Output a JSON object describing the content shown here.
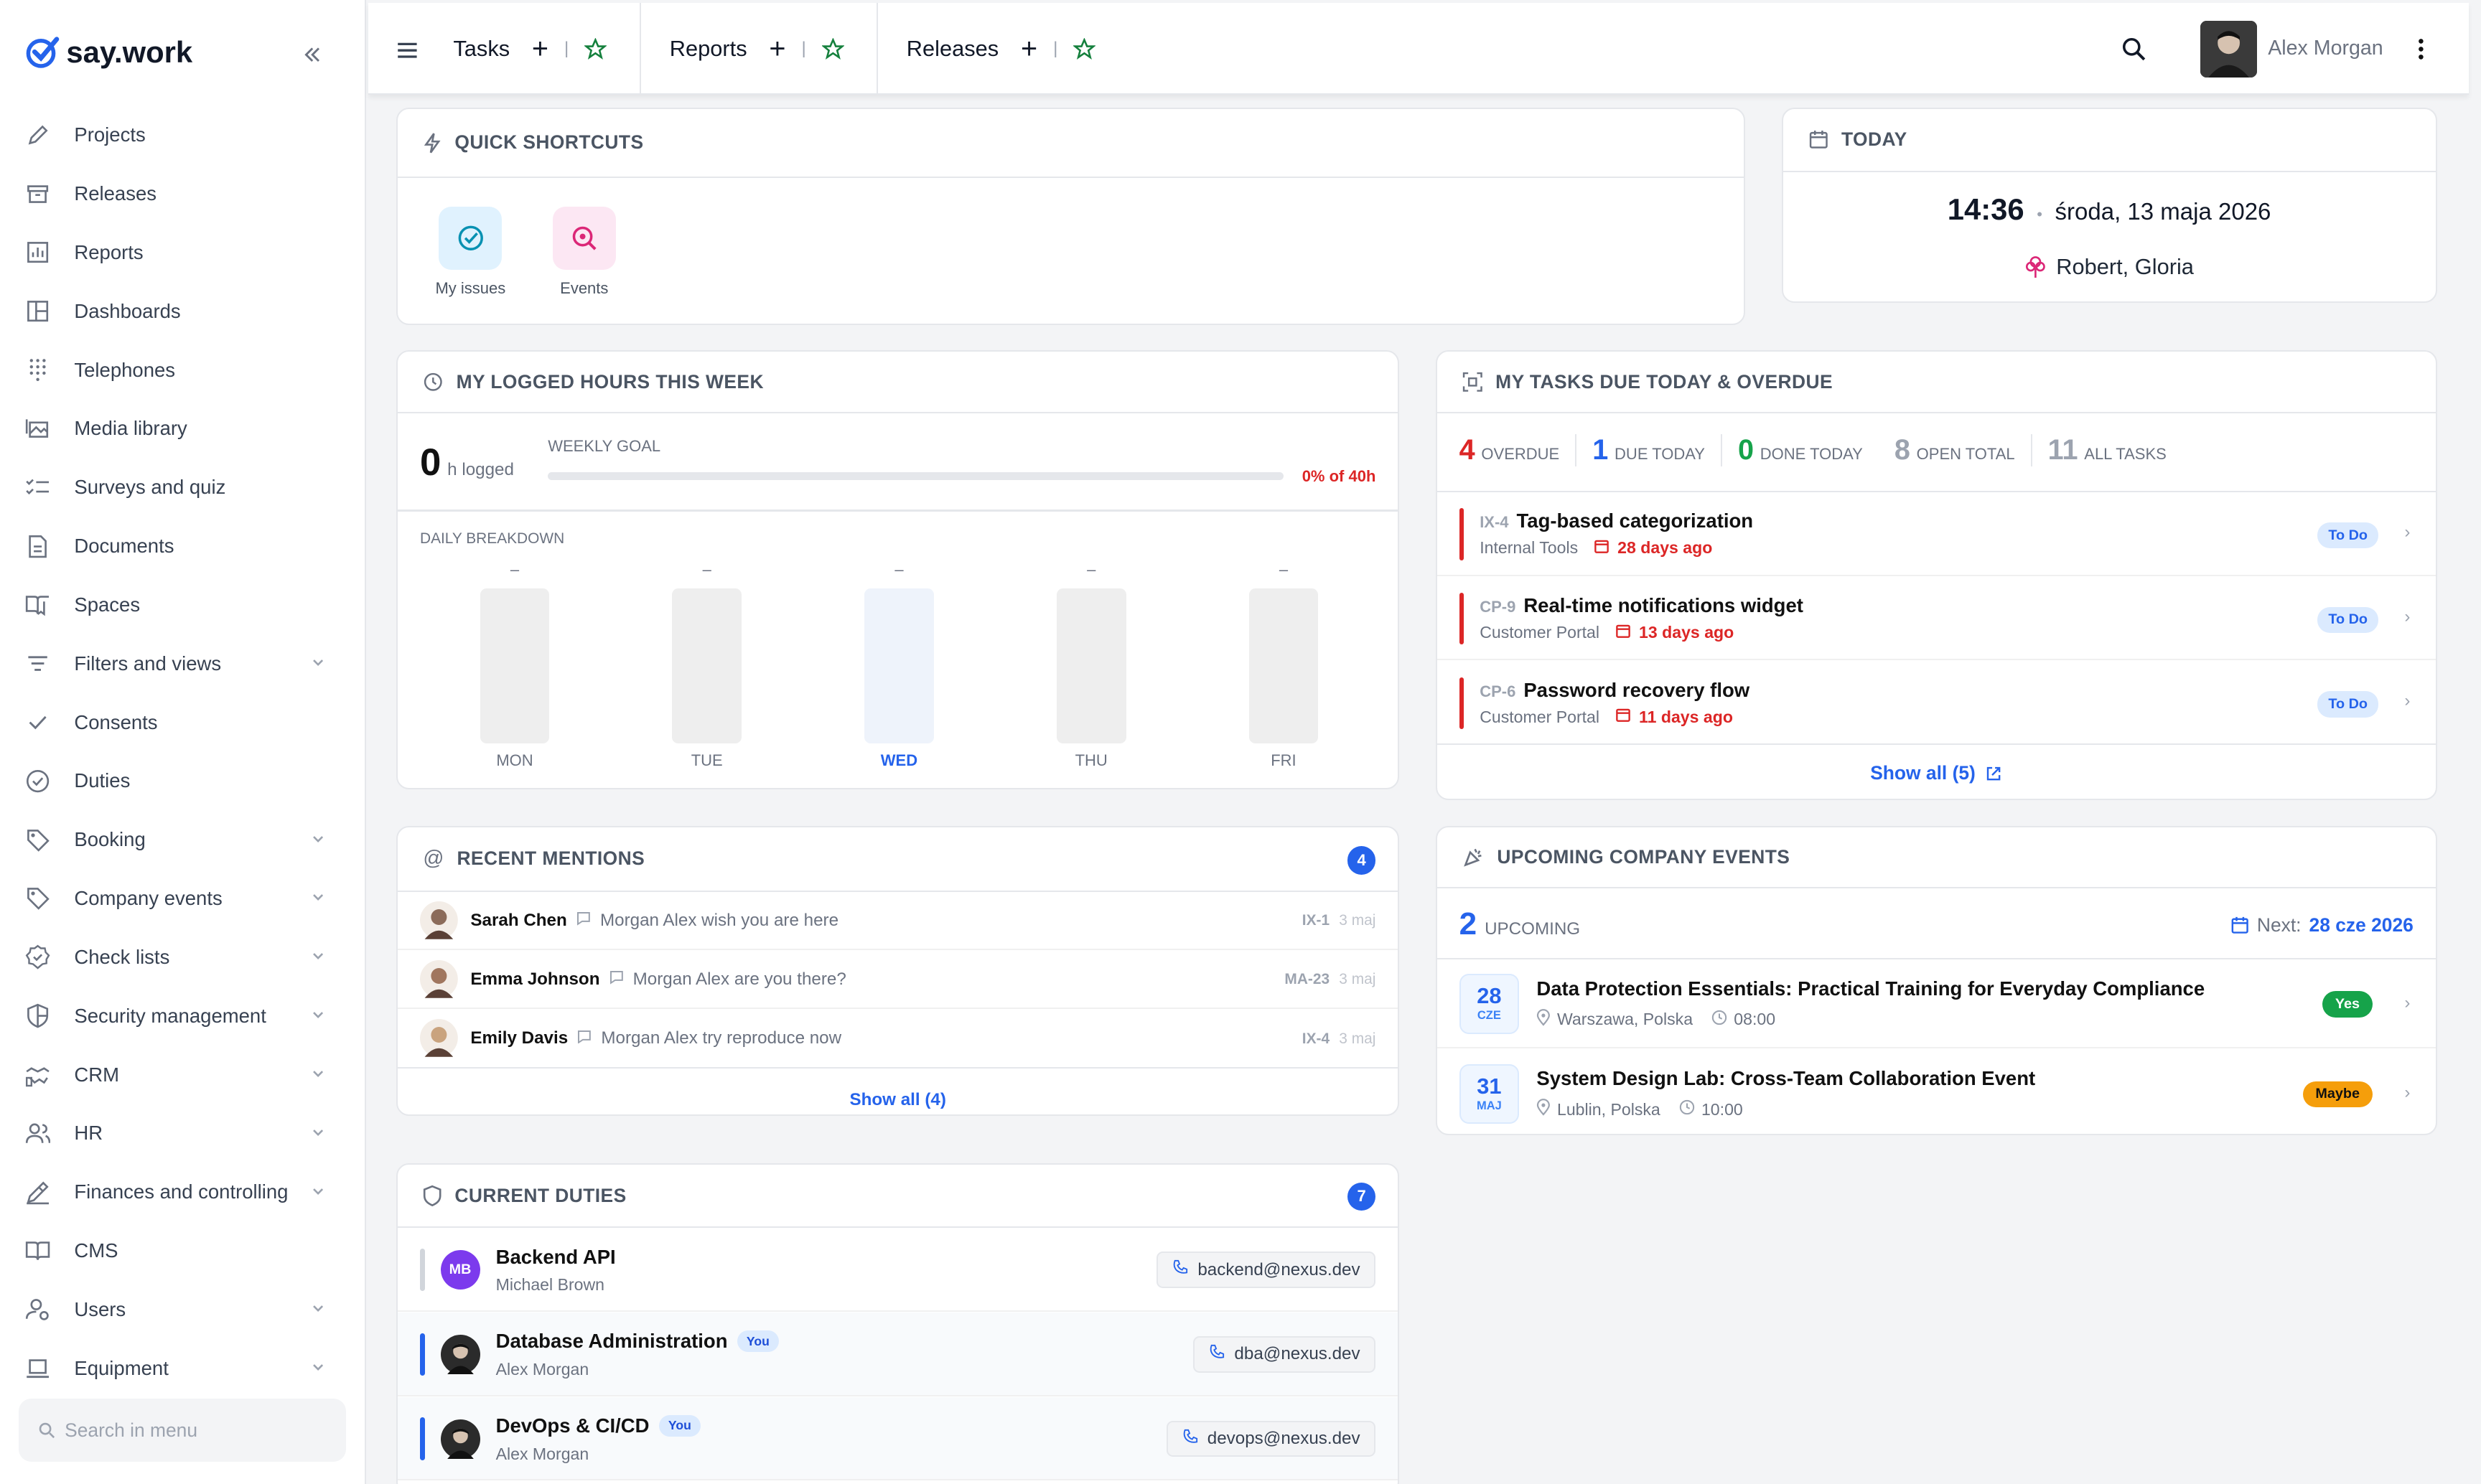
{
  "app": {
    "name": "say.work"
  },
  "sidebar": {
    "items": [
      {
        "label": "Projects",
        "icon": "pencil-icon",
        "chevron": false
      },
      {
        "label": "Releases",
        "icon": "archive-icon",
        "chevron": false
      },
      {
        "label": "Reports",
        "icon": "bar-chart-icon",
        "chevron": false
      },
      {
        "label": "Dashboards",
        "icon": "layout-icon",
        "chevron": false
      },
      {
        "label": "Telephones",
        "icon": "keypad-icon",
        "chevron": false
      },
      {
        "label": "Media library",
        "icon": "images-icon",
        "chevron": false
      },
      {
        "label": "Surveys and quiz",
        "icon": "checklist-icon",
        "chevron": false
      },
      {
        "label": "Documents",
        "icon": "document-icon",
        "chevron": false
      },
      {
        "label": "Spaces",
        "icon": "book-open-icon",
        "chevron": false
      },
      {
        "label": "Filters and views",
        "icon": "filter-icon",
        "chevron": true
      },
      {
        "label": "Consents",
        "icon": "check-icon",
        "chevron": false
      },
      {
        "label": "Duties",
        "icon": "check-circle-icon",
        "chevron": false
      },
      {
        "label": "Booking",
        "icon": "tag-icon",
        "chevron": true
      },
      {
        "label": "Company events",
        "icon": "tag-icon",
        "chevron": true
      },
      {
        "label": "Check lists",
        "icon": "badge-check-icon",
        "chevron": true
      },
      {
        "label": "Security management",
        "icon": "shield-icon",
        "chevron": true
      },
      {
        "label": "CRM",
        "icon": "handshake-icon",
        "chevron": true
      },
      {
        "label": "HR",
        "icon": "users-icon",
        "chevron": true
      },
      {
        "label": "Finances and controlling",
        "icon": "edit-icon",
        "chevron": true
      },
      {
        "label": "CMS",
        "icon": "book-icon",
        "chevron": false
      },
      {
        "label": "Users",
        "icon": "user-settings-icon",
        "chevron": true
      },
      {
        "label": "Equipment",
        "icon": "laptop-icon",
        "chevron": true
      }
    ],
    "search_placeholder": "Search in menu"
  },
  "topbar": {
    "tabs": [
      {
        "label": "Tasks"
      },
      {
        "label": "Reports"
      },
      {
        "label": "Releases"
      }
    ],
    "user": {
      "name": "Alex Morgan"
    }
  },
  "quick_shortcuts": {
    "title": "QUICK SHORTCUTS",
    "items": [
      {
        "label": "My issues",
        "icon": "check-circle-icon",
        "color": "#0891b2"
      },
      {
        "label": "Events",
        "icon": "search-zoom-icon",
        "color": "#db2777"
      }
    ]
  },
  "today": {
    "title": "TODAY",
    "time": "14:36",
    "date": "środa, 13 maja 2026",
    "names": "Robert, Gloria"
  },
  "logged_hours": {
    "title": "MY LOGGED HOURS THIS WEEK",
    "value": "0",
    "unit": "h logged",
    "goal_label": "WEEKLY GOAL",
    "goal_text": "0% of 40h",
    "goal_fraction": 0,
    "breakdown_label": "DAILY BREAKDOWN",
    "days": [
      {
        "label": "MON",
        "value": "–",
        "active": false
      },
      {
        "label": "TUE",
        "value": "–",
        "active": false
      },
      {
        "label": "WED",
        "value": "–",
        "active": true
      },
      {
        "label": "THU",
        "value": "–",
        "active": false
      },
      {
        "label": "FRI",
        "value": "–",
        "active": false
      }
    ]
  },
  "tasks": {
    "title": "MY TASKS DUE TODAY & OVERDUE",
    "stats": [
      {
        "value": "4",
        "label": "OVERDUE",
        "color": "#dc2626"
      },
      {
        "value": "1",
        "label": "DUE TODAY",
        "color": "#2563eb"
      },
      {
        "value": "0",
        "label": "DONE TODAY",
        "color": "#16a34a"
      },
      {
        "value": "8",
        "label": "OPEN TOTAL",
        "color": "#9ca3af"
      },
      {
        "value": "11",
        "label": "ALL TASKS",
        "color": "#9ca3af"
      }
    ],
    "items": [
      {
        "key": "IX-4",
        "title": "Tag-based categorization",
        "project": "Internal Tools",
        "due": "28 days ago",
        "status": "To Do"
      },
      {
        "key": "CP-9",
        "title": "Real-time notifications widget",
        "project": "Customer Portal",
        "due": "13 days ago",
        "status": "To Do"
      },
      {
        "key": "CP-6",
        "title": "Password recovery flow",
        "project": "Customer Portal",
        "due": "11 days ago",
        "status": "To Do"
      }
    ],
    "show_all": "Show all (5)"
  },
  "mentions": {
    "title": "RECENT MENTIONS",
    "count": "4",
    "items": [
      {
        "name": "Sarah Chen",
        "text": "Morgan Alex wish you are here",
        "key": "IX-1",
        "date": "3 maj"
      },
      {
        "name": "Emma Johnson",
        "text": "Morgan Alex are you there?",
        "key": "MA-23",
        "date": "3 maj"
      },
      {
        "name": "Emily Davis",
        "text": "Morgan Alex try reproduce now",
        "key": "IX-4",
        "date": "3 maj"
      }
    ],
    "show_all": "Show all (4)"
  },
  "events": {
    "title": "UPCOMING COMPANY EVENTS",
    "count": "2",
    "count_label": "UPCOMING",
    "next_label": "Next:",
    "next_date": "28 cze 2026",
    "items": [
      {
        "day": "28",
        "month": "CZE",
        "title": "Data Protection Essentials: Practical Training for Everyday Compliance",
        "location": "Warszawa, Polska",
        "time": "08:00",
        "rsvp": "Yes",
        "rsvp_color": "#16a34a"
      },
      {
        "day": "31",
        "month": "MAJ",
        "title": "System Design Lab: Cross-Team Collaboration Event",
        "location": "Lublin, Polska",
        "time": "10:00",
        "rsvp": "Maybe",
        "rsvp_color": "#f59e0b"
      }
    ]
  },
  "duties": {
    "title": "CURRENT DUTIES",
    "count": "7",
    "items": [
      {
        "title": "Backend API",
        "person": "Michael Brown",
        "initials": "MB",
        "you": false,
        "email": "backend@nexus.dev"
      },
      {
        "title": "Database Administration",
        "person": "Alex Morgan",
        "initials": "",
        "you": true,
        "you_label": "You",
        "email": "dba@nexus.dev"
      },
      {
        "title": "DevOps & CI/CD",
        "person": "Alex Morgan",
        "initials": "",
        "you": true,
        "you_label": "You",
        "email": "devops@nexus.dev"
      }
    ]
  }
}
